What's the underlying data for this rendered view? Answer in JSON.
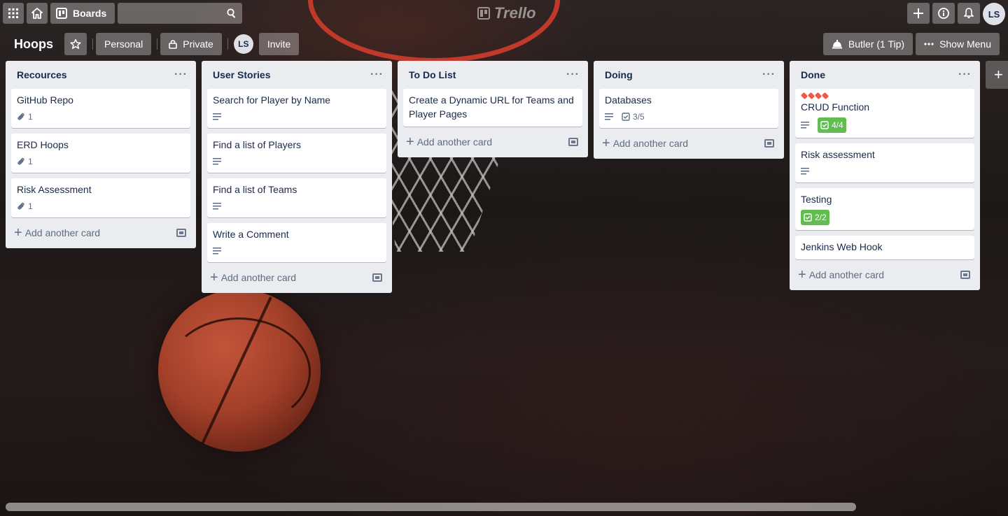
{
  "topbar": {
    "boards_label": "Boards",
    "logo_text": "Trello",
    "user_initials": "LS"
  },
  "board": {
    "title": "Hoops",
    "team_label": "Personal",
    "visibility_label": "Private",
    "member_initials": "LS",
    "invite_label": "Invite",
    "butler_label": "Butler (1 Tip)",
    "menu_label": "Show Menu"
  },
  "lists": [
    {
      "title": "Recources",
      "cards": [
        {
          "title": "GitHub Repo",
          "attachments": "1"
        },
        {
          "title": "ERD Hoops",
          "attachments": "1"
        },
        {
          "title": "Risk Assessment",
          "attachments": "1"
        }
      ],
      "add_label": "Add another card"
    },
    {
      "title": "User Stories",
      "cards": [
        {
          "title": "Search for Player by Name"
        },
        {
          "title": "Find a list of Players"
        },
        {
          "title": "Find a list of Teams"
        },
        {
          "title": "Write a Comment"
        }
      ],
      "add_label": "Add another card"
    },
    {
      "title": "To Do List",
      "cards": [
        {
          "title": "Create a Dynamic URL for Teams and Player Pages"
        }
      ],
      "add_label": "Add another card"
    },
    {
      "title": "Doing",
      "cards": [
        {
          "title": "Databases",
          "checklist": "3/5"
        }
      ],
      "add_label": "Add another card"
    },
    {
      "title": "Done",
      "cards": [
        {
          "title": "CRUD Function",
          "checklist": "4/4"
        },
        {
          "title": "Risk assessment"
        },
        {
          "title": "Testing",
          "checklist": "2/2"
        },
        {
          "title": "Jenkins Web Hook"
        }
      ],
      "add_label": "Add another card"
    }
  ],
  "colors": {
    "label_red": "#eb5a46",
    "checklist_complete": "#61bd4f",
    "list_bg": "#ebecf0"
  }
}
